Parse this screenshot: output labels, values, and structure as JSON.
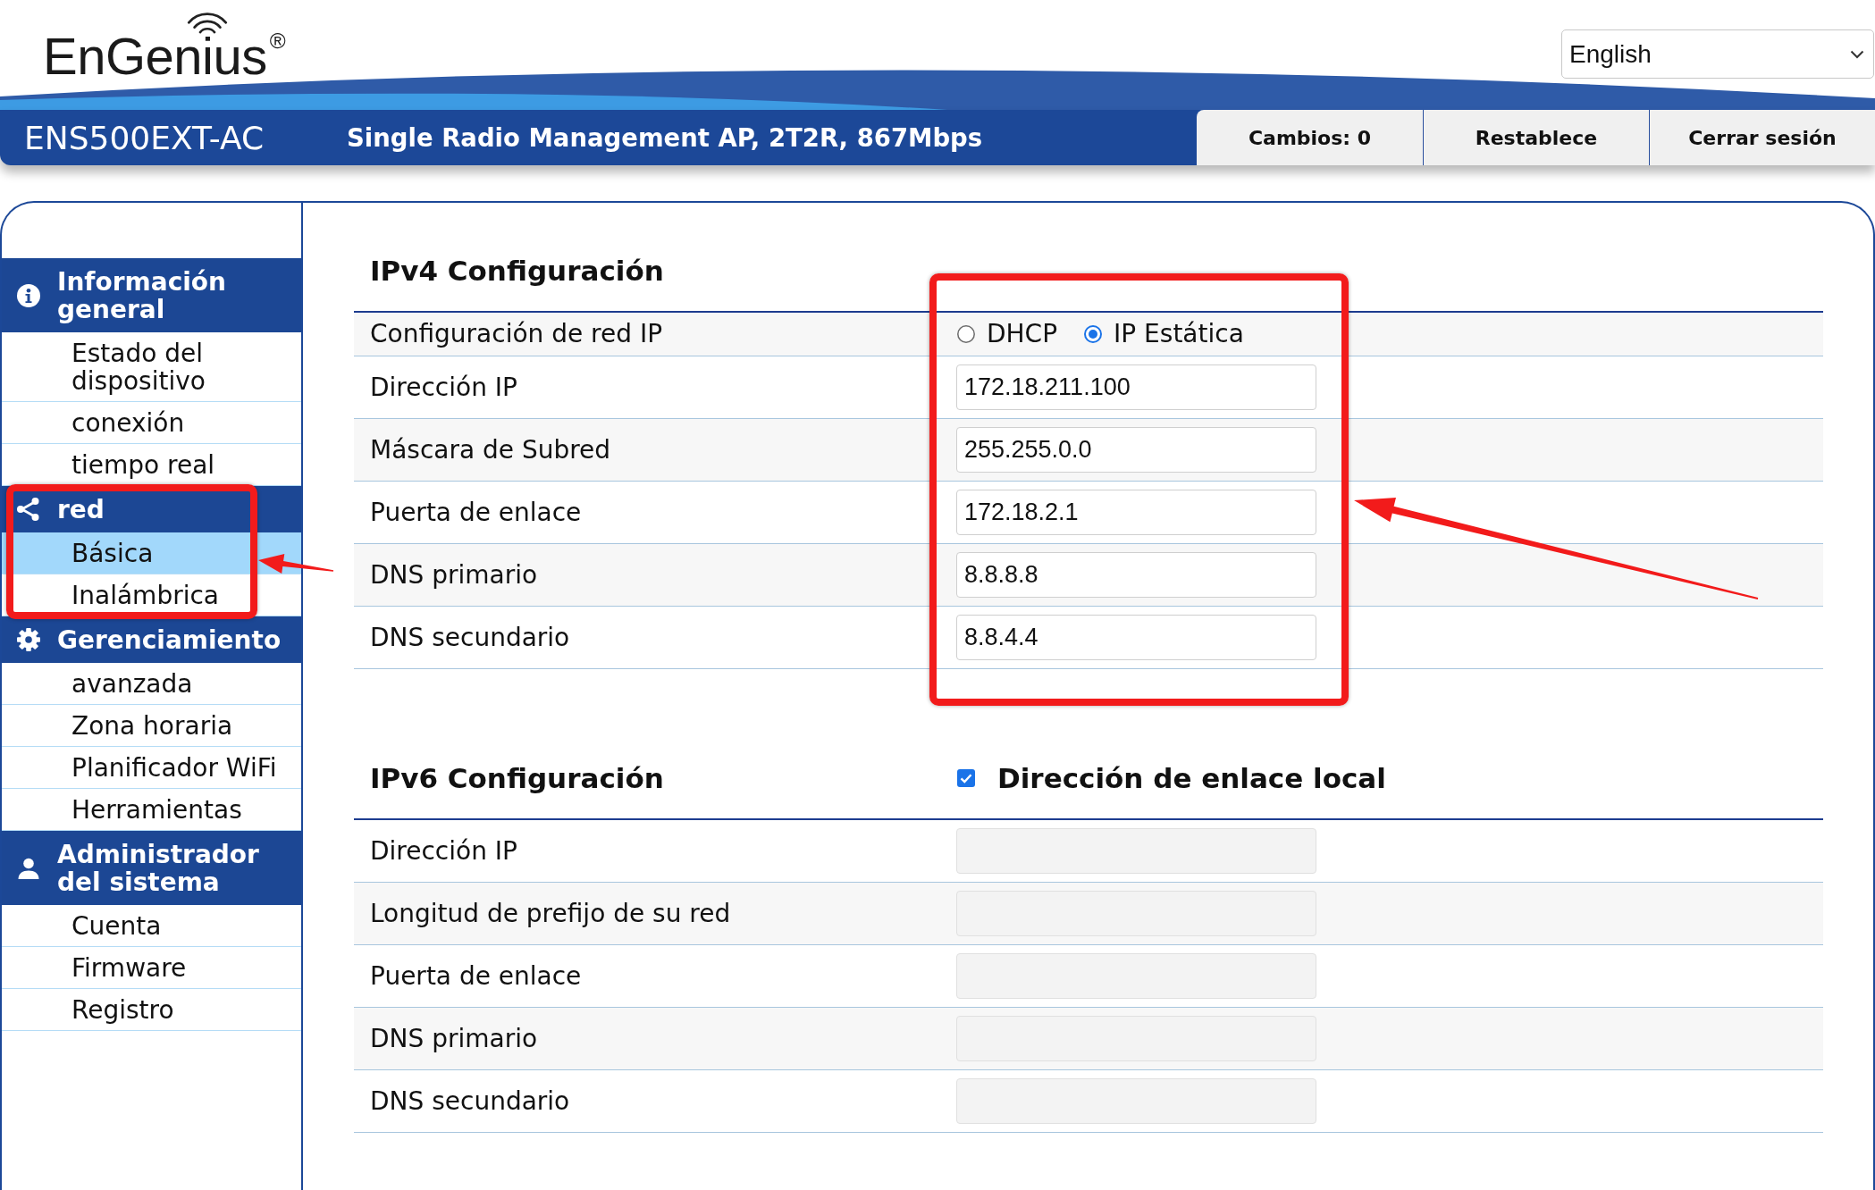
{
  "header": {
    "logo": "EnGenius$^{®}$",
    "language": "English",
    "model": "ENS500EXT-AC",
    "description": "Single Radio Management AP, 2T2R, 867Mbps",
    "buttons": [
      "Cambios: 0",
      "Restablece",
      "Cerrar sesión"
    ]
  },
  "sidebar": {
    "groups": [
      {
        "kind": "info",
        "title": "Información general",
        "annotated": false,
        "items": [
          {
            "label": "Estado del dispositivo",
            "selected": false
          },
          {
            "label": "conexión",
            "selected": false
          },
          {
            "label": "tiempo real",
            "selected": false
          }
        ]
      },
      {
        "kind": "network",
        "title": "red",
        "annotated": true,
        "items": [
          {
            "label": "Básica",
            "selected": true
          },
          {
            "label": "Inalámbrica",
            "selected": false
          }
        ]
      },
      {
        "kind": "settings",
        "title": "Gerenciamiento",
        "annotated": false,
        "items": [
          {
            "label": "avanzada",
            "selected": false
          },
          {
            "label": "Zona horaria",
            "selected": false
          },
          {
            "label": "Planificador WiFi",
            "selected": false
          },
          {
            "label": "Herramientas",
            "selected": false
          }
        ]
      },
      {
        "kind": "user",
        "title": "Administrador del sistema",
        "annotated": false,
        "items": [
          {
            "label": "Cuenta",
            "selected": false
          },
          {
            "label": "Firmware",
            "selected": false
          },
          {
            "label": "Registro",
            "selected": false
          }
        ]
      }
    ]
  },
  "ipv4": {
    "title": "IPv4 Configuración",
    "annotated": true,
    "rows": [
      {
        "kind": "radio",
        "label": "Configuración de red IP",
        "disabled": false,
        "options": [
          {
            "label": "DHCP",
            "selected": false
          },
          {
            "label": "IP Estática",
            "selected": true
          }
        ]
      },
      {
        "kind": "input",
        "label": "Dirección IP",
        "value": "172.18.211.100",
        "disabled": false
      },
      {
        "kind": "input",
        "label": "Máscara de Subred",
        "value": "255.255.0.0",
        "disabled": false
      },
      {
        "kind": "input",
        "label": "Puerta de enlace",
        "value": "172.18.2.1",
        "disabled": false
      },
      {
        "kind": "input",
        "label": "DNS primario",
        "value": "8.8.8.8",
        "disabled": false
      },
      {
        "kind": "input",
        "label": "DNS secundario",
        "value": "8.8.4.4",
        "disabled": false
      }
    ]
  },
  "ipv6": {
    "title": "IPv6 Configuración",
    "annotated": false,
    "option": {
      "label": "Dirección de enlace local",
      "checked": true
    },
    "rows": [
      {
        "kind": "input",
        "label": "Dirección IP",
        "disabled": true
      },
      {
        "kind": "input",
        "label": "Longitud de prefijo de su red",
        "disabled": true
      },
      {
        "kind": "input",
        "label": "Puerta de enlace",
        "disabled": true
      },
      {
        "kind": "input",
        "label": "DNS primario",
        "disabled": true
      },
      {
        "kind": "input",
        "label": "DNS secundario",
        "disabled": true
      }
    ]
  }
}
